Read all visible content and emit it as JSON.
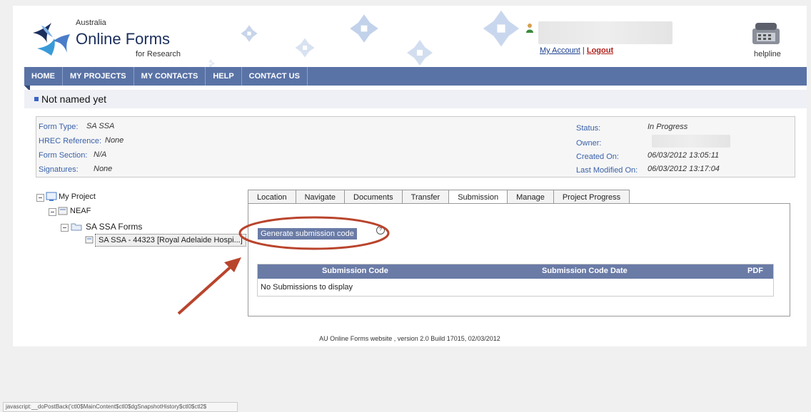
{
  "brand": {
    "small": "Australia",
    "big": "Online Forms",
    "sub": "for Research"
  },
  "account": {
    "my_account": "My Account",
    "separator": "|",
    "logout": "Logout"
  },
  "helpline": "helpline",
  "nav": {
    "items": [
      "HOME",
      "MY PROJECTS",
      "MY CONTACTS",
      "HELP",
      "CONTACT US"
    ]
  },
  "page_title": "Not named yet",
  "info": {
    "form_type_label": "Form Type:",
    "form_type": "SA SSA",
    "hrec_label": "HREC Reference:",
    "hrec": "None",
    "section_label": "Form Section:",
    "section": "N/A",
    "signatures_label": "Signatures:",
    "signatures": "None",
    "status_label": "Status:",
    "status": "In Progress",
    "owner_label": "Owner:",
    "created_label": "Created On:",
    "created": "06/03/2012 13:05:11",
    "modified_label": "Last Modified On:",
    "modified": "06/03/2012 13:17:04"
  },
  "tree": {
    "root": "My Project",
    "neaf": "NEAF",
    "forms": "SA SSA Forms",
    "selected": "SA SSA - 44323 [Royal Adelaide Hospi...]"
  },
  "tabs": [
    "Location",
    "Navigate",
    "Documents",
    "Transfer",
    "Submission",
    "Manage",
    "Project Progress"
  ],
  "active_tab": "Submission",
  "submission": {
    "generate_button": "Generate submission code",
    "columns": [
      "Submission Code",
      "Submission Code Date",
      "PDF"
    ],
    "empty_text": "No Submissions to display"
  },
  "footer": "AU Online Forms website , version 2.0 Build 17015, 02/03/2012",
  "status_bar": "javascript:__doPostBack('ctl0$MainContent$ctl0$dgSnapshotHistory$ctl0$ctl2$"
}
